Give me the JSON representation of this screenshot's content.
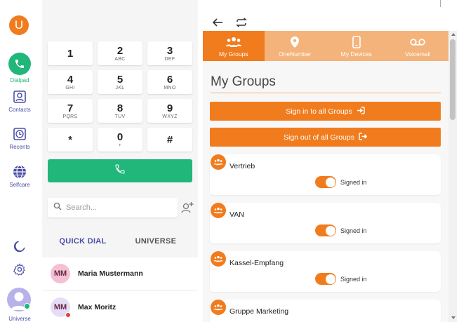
{
  "rail": {
    "logo_letter": "U",
    "items": [
      {
        "label": "Dialpad"
      },
      {
        "label": "Contacts"
      },
      {
        "label": "Recents"
      },
      {
        "label": "Selfcare"
      }
    ],
    "user_label": "Universe"
  },
  "dialpad": {
    "keys": [
      {
        "num": "1",
        "sub": ""
      },
      {
        "num": "2",
        "sub": "ABC"
      },
      {
        "num": "3",
        "sub": "DEF"
      },
      {
        "num": "4",
        "sub": "GHI"
      },
      {
        "num": "5",
        "sub": "JKL"
      },
      {
        "num": "6",
        "sub": "MNO"
      },
      {
        "num": "7",
        "sub": "PQRS"
      },
      {
        "num": "8",
        "sub": "TUV"
      },
      {
        "num": "9",
        "sub": "WXYZ"
      },
      {
        "num": "*",
        "sub": ""
      },
      {
        "num": "0",
        "sub": "+"
      },
      {
        "num": "#",
        "sub": ""
      }
    ],
    "search_placeholder": "Search..."
  },
  "contacts_tabs": {
    "quick_dial": "QUICK DIAL",
    "universe": "UNIVERSE"
  },
  "contacts": [
    {
      "initials": "MM",
      "name": "Maria Mustermann",
      "avatar_color": "#f4c1d3"
    },
    {
      "initials": "MM",
      "name": "Max Moritz",
      "avatar_color": "#e7dcf5",
      "status_color": "#e0453a"
    }
  ],
  "tabs": [
    {
      "label": "My Groups",
      "active": true
    },
    {
      "label": "OneNumber",
      "active": false
    },
    {
      "label": "My Devices",
      "active": false
    },
    {
      "label": "Voicemail",
      "active": false
    }
  ],
  "panel": {
    "title": "My Groups",
    "sign_in_all": "Sign in to all Groups",
    "sign_out_all": "Sign out of all Groups"
  },
  "groups": [
    {
      "name": "Vertrieb",
      "status": "Signed in",
      "signed_in": true
    },
    {
      "name": "VAN",
      "status": "Signed in",
      "signed_in": true
    },
    {
      "name": "Kassel-Empfang",
      "status": "Signed in",
      "signed_in": true
    },
    {
      "name": "Gruppe Marketing",
      "status": "",
      "signed_in": true
    }
  ],
  "colors": {
    "accent": "#f07c1e",
    "accent_light": "#f4b37a",
    "green": "#21b67a",
    "brand_purple": "#4b4fa8"
  }
}
